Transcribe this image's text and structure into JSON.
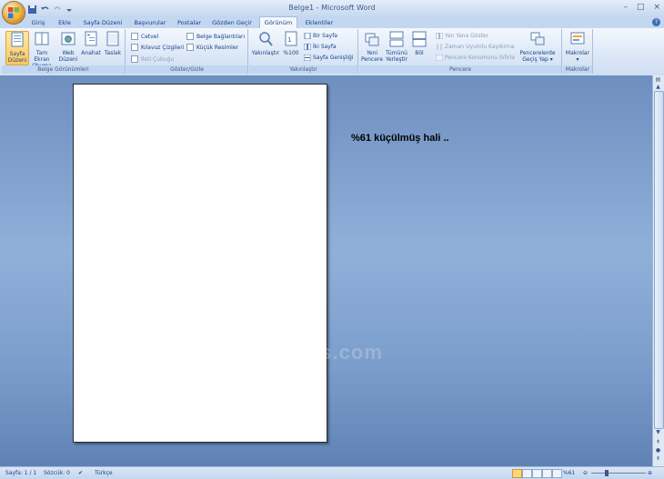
{
  "app": {
    "title": "Belge1 - Microsoft Word",
    "window_controls": [
      "–",
      "□",
      "×"
    ],
    "help": "?"
  },
  "tabs": [
    {
      "label": "Giriş"
    },
    {
      "label": "Ekle"
    },
    {
      "label": "Sayfa Düzeni"
    },
    {
      "label": "Başvurular"
    },
    {
      "label": "Postalar"
    },
    {
      "label": "Gözden Geçir"
    },
    {
      "label": "Görünüm",
      "active": true
    },
    {
      "label": "Eklentiler"
    }
  ],
  "ribbon": {
    "belge_gorunumleri": {
      "label": "Belge Görünümleri",
      "buttons": [
        {
          "label": "Sayfa\nDüzeni",
          "selected": true
        },
        {
          "label": "Tam Ekran\nOkuma"
        },
        {
          "label": "Web\nDüzeni"
        },
        {
          "label": "Anahat"
        },
        {
          "label": "Taslak"
        }
      ]
    },
    "goster_gizle": {
      "label": "Göster/Gizle",
      "checks": [
        {
          "label": "Cetvel"
        },
        {
          "label": "Kılavuz Çizgileri"
        },
        {
          "label": "İleti Çubuğu",
          "disabled": true
        },
        {
          "label": "Belge Bağlantıları"
        },
        {
          "label": "Küçük Resimler"
        }
      ]
    },
    "yakinlastir": {
      "label": "Yakınlaştır",
      "big": [
        {
          "label": "Yakınlaştır"
        },
        {
          "label": "%100"
        }
      ],
      "small": [
        {
          "label": "Bir Sayfa"
        },
        {
          "label": "İki Sayfa"
        },
        {
          "label": "Sayfa Genişliği"
        }
      ]
    },
    "pencere": {
      "label": "Pencere",
      "big": [
        {
          "label": "Yeni\nPencere"
        },
        {
          "label": "Tümünü\nYerleştir"
        },
        {
          "label": "Böl"
        }
      ],
      "small": [
        {
          "label": "Yan Yana Göster",
          "disabled": true
        },
        {
          "label": "Zaman Uyumlu Kaydırma",
          "disabled": true
        },
        {
          "label": "Pencere Konumunu Sıfırla",
          "disabled": true
        }
      ],
      "switch": {
        "label": "Pencerelerde\nGeçiş Yap ▾"
      }
    },
    "makrolar": {
      "label": "Makrolar",
      "button": {
        "label": "Makrolar\n▾"
      }
    }
  },
  "document": {
    "note": "%61 küçülmüş hali ..",
    "watermark": "www.dijitalders.com"
  },
  "status": {
    "page": "Sayfa: 1 / 1",
    "words": "Sözcük: 0",
    "language": "Türkçe",
    "zoom": "%61",
    "zoom_value": 61
  }
}
